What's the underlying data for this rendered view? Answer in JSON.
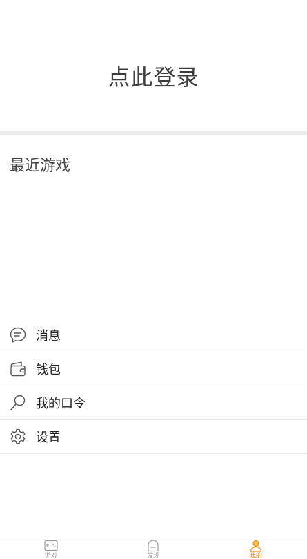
{
  "header": {
    "login_label": "点此登录"
  },
  "recent": {
    "title": "最近游戏"
  },
  "menu": {
    "items": [
      {
        "label": "消息",
        "icon": "message-icon"
      },
      {
        "label": "钱包",
        "icon": "wallet-icon"
      },
      {
        "label": "我的口令",
        "icon": "search-key-icon"
      },
      {
        "label": "设置",
        "icon": "gear-icon"
      }
    ]
  },
  "tabbar": {
    "items": [
      {
        "label": "游戏",
        "icon": "gamepad-icon",
        "active": false
      },
      {
        "label": "发现",
        "icon": "discover-icon",
        "active": false
      },
      {
        "label": "我的",
        "icon": "user-icon",
        "active": true
      }
    ],
    "active_color": "#f08a1c",
    "inactive_color": "#9a9a9a"
  }
}
